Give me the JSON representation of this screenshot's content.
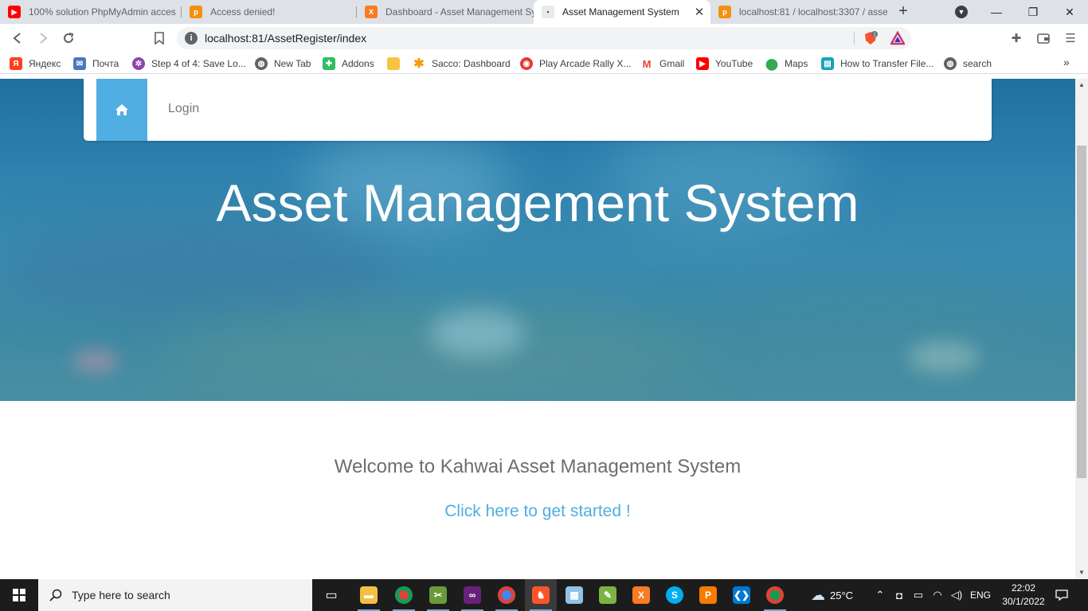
{
  "browser": {
    "tabs": [
      {
        "title": "100% solution PhpMyAdmin acces",
        "icon": "youtube-icon",
        "color": "#ff0000"
      },
      {
        "title": "Access denied!",
        "icon": "phpmyadmin-icon",
        "color": "#f29111"
      },
      {
        "title": "Dashboard - Asset Management Sy",
        "icon": "xampp-icon",
        "color": "#fb7a24"
      },
      {
        "title": "Asset Management System",
        "icon": "site-icon",
        "active": true
      },
      {
        "title": "localhost:81 / localhost:3307 / asse",
        "icon": "phpmyadmin-icon",
        "color": "#f29111"
      }
    ],
    "url": "localhost:81/AssetRegister/index",
    "rewards_badge": "1",
    "bookmarks": [
      {
        "label": "Яндекс",
        "icon": "yandex-icon",
        "color": "#fc3f1d"
      },
      {
        "label": "Почта",
        "icon": "mail-icon",
        "color": "#4a78c2"
      },
      {
        "label": "Step 4 of 4: Save Lo...",
        "icon": "pinwheel-icon",
        "color": "#8e44ad"
      },
      {
        "label": "New Tab",
        "icon": "globe-icon",
        "color": "#5f6368"
      },
      {
        "label": "Addons",
        "icon": "puzzle-icon",
        "color": "#2dbe60"
      },
      {
        "label": "",
        "icon": "folder-icon",
        "color": "#f6c343"
      },
      {
        "label": "Sacco: Dashboard",
        "icon": "asterisk-icon",
        "color": "#f39c12"
      },
      {
        "label": "Play Arcade Rally X...",
        "icon": "gamepad-icon",
        "color": "#e53935"
      },
      {
        "label": "Gmail",
        "icon": "gmail-icon",
        "color": "#ea4335"
      },
      {
        "label": "YouTube",
        "icon": "youtube-icon",
        "color": "#ff0000"
      },
      {
        "label": "Maps",
        "icon": "maps-pin-icon",
        "color": "#34a853"
      },
      {
        "label": "How to Transfer File...",
        "icon": "page-icon",
        "color": "#1aa3b8"
      },
      {
        "label": "search",
        "icon": "globe-icon",
        "color": "#5f6368"
      }
    ]
  },
  "page": {
    "nav": {
      "home_icon": "home-icon",
      "login": "Login"
    },
    "hero_title": "Asset Management System",
    "welcome": "Welcome to Kahwai Asset Management System",
    "cta": "Click here to get started !",
    "colors": {
      "accent": "#51aee3",
      "link": "#4faee0",
      "hero": "#2e82ae"
    }
  },
  "taskbar": {
    "search_placeholder": "Type here to search",
    "apps": [
      {
        "name": "task-view-icon"
      },
      {
        "name": "file-explorer-icon"
      },
      {
        "name": "chrome-icon"
      },
      {
        "name": "tool-icon"
      },
      {
        "name": "visual-studio-icon"
      },
      {
        "name": "chrome-profile-icon"
      },
      {
        "name": "brave-icon"
      },
      {
        "name": "notepad-icon"
      },
      {
        "name": "editor-icon"
      },
      {
        "name": "xampp-icon"
      },
      {
        "name": "skype-icon"
      },
      {
        "name": "pdf-icon"
      },
      {
        "name": "vscode-icon"
      },
      {
        "name": "chrome-alt-icon"
      }
    ],
    "weather_temp": "25°C",
    "language": "ENG",
    "time": "22:02",
    "date": "30/1/2022"
  }
}
